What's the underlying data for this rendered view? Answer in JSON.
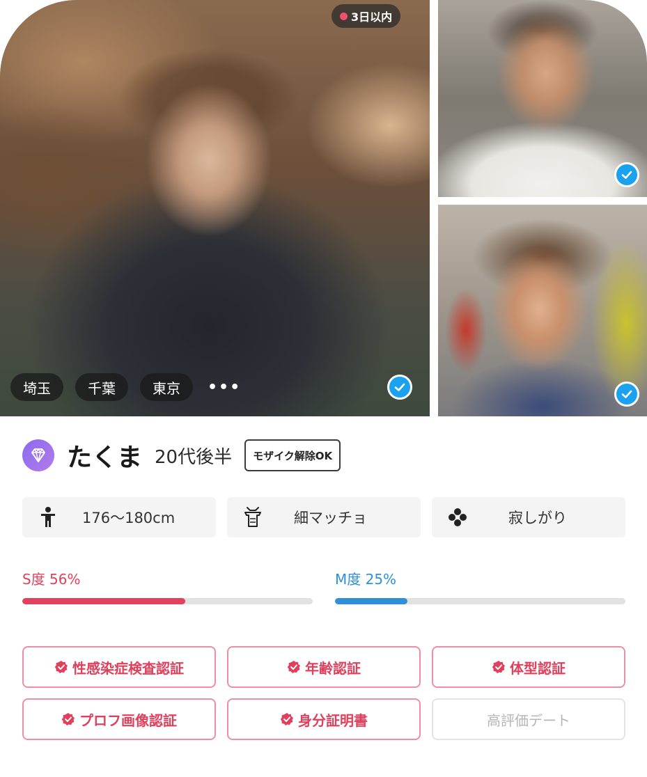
{
  "photos": {
    "online_status": "3日以内",
    "area_tags": [
      "埼玉",
      "千葉",
      "東京"
    ],
    "more_indicator": "•••"
  },
  "profile": {
    "name": "たくま",
    "age": "20代後半",
    "mosaic_badge": "モザイク解除OK"
  },
  "attributes": [
    {
      "icon": "person-icon",
      "label": "176〜180cm"
    },
    {
      "icon": "body-type-icon",
      "label": "細マッチョ"
    },
    {
      "icon": "personality-icon",
      "label": "寂しがり"
    }
  ],
  "gauges": {
    "s": {
      "label": "S度 56%",
      "percent": 56,
      "color": "#e2405c"
    },
    "m": {
      "label": "M度 25%",
      "percent": 25,
      "color": "#2f8fd8"
    }
  },
  "certifications": [
    {
      "label": "性感染症検査認証",
      "active": true
    },
    {
      "label": "年齢認証",
      "active": true
    },
    {
      "label": "体型認証",
      "active": true
    },
    {
      "label": "プロフ画像認証",
      "active": true
    },
    {
      "label": "身分証明書",
      "active": true
    },
    {
      "label": "高評価デート",
      "active": false
    }
  ],
  "colors": {
    "accent_pink": "#e0405c",
    "verify_blue": "#1aa1f0",
    "rank_purple": "#8a6bf0"
  }
}
